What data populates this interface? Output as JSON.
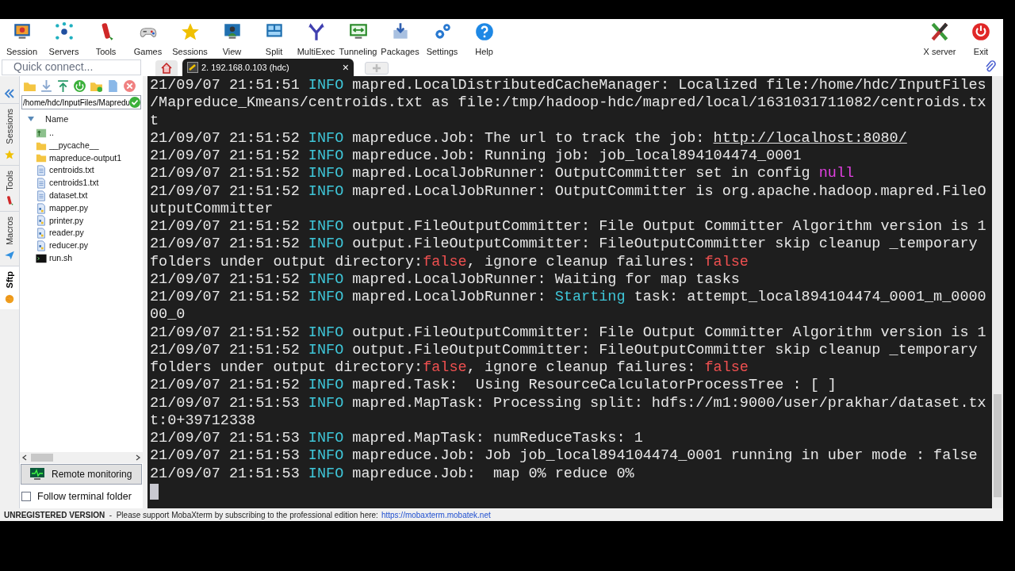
{
  "toolbar": [
    {
      "label": "Session"
    },
    {
      "label": "Servers"
    },
    {
      "label": "Tools"
    },
    {
      "label": "Games"
    },
    {
      "label": "Sessions"
    },
    {
      "label": "View"
    },
    {
      "label": "Split"
    },
    {
      "label": "MultiExec"
    },
    {
      "label": "Tunneling"
    },
    {
      "label": "Packages"
    },
    {
      "label": "Settings"
    },
    {
      "label": "Help"
    }
  ],
  "toolbar_right": [
    {
      "label": "X server"
    },
    {
      "label": "Exit"
    }
  ],
  "quick_connect": {
    "placeholder": "Quick connect..."
  },
  "tabs": [
    {
      "kind": "home",
      "selected": false
    },
    {
      "kind": "session",
      "label": "2. 192.168.0.103 (hdc)",
      "close": "×",
      "selected": true
    },
    {
      "kind": "new",
      "selected": false
    }
  ],
  "side_tabs": [
    {
      "label": "Sessions",
      "selected": false
    },
    {
      "label": "Tools",
      "selected": false
    },
    {
      "label": "Macros",
      "selected": false
    },
    {
      "label": "Sftp",
      "selected": true
    }
  ],
  "sftp": {
    "path": "/home/hdc/InputFiles/Mapredu",
    "column": "Name",
    "files": [
      {
        "name": "..",
        "kind": "parent"
      },
      {
        "name": "__pycache__",
        "kind": "folder"
      },
      {
        "name": "mapreduce-output1",
        "kind": "folder"
      },
      {
        "name": "centroids.txt",
        "kind": "text"
      },
      {
        "name": "centroids1.txt",
        "kind": "text"
      },
      {
        "name": "dataset.txt",
        "kind": "text"
      },
      {
        "name": "mapper.py",
        "kind": "python"
      },
      {
        "name": "printer.py",
        "kind": "python"
      },
      {
        "name": "reader.py",
        "kind": "python"
      },
      {
        "name": "reducer.py",
        "kind": "python"
      },
      {
        "name": "run.sh",
        "kind": "script"
      }
    ],
    "remote_monitoring": "Remote monitoring",
    "follow_folder": {
      "label": "Follow terminal folder",
      "checked": false
    }
  },
  "terminal": [
    [
      {
        "kind": "text",
        "text": "21/09/07 21:51:51 "
      },
      {
        "kind": "info",
        "text": "INFO"
      },
      {
        "kind": "text",
        "text": " mapred.LocalDistributedCacheManager: Localized file:/home/hdc/InputFiles"
      }
    ],
    [
      {
        "kind": "text",
        "text": "/Mapreduce_Kmeans/centroids.txt as file:/tmp/hadoop-hdc/mapred/local/1631031711082/centroids.tx"
      }
    ],
    [
      {
        "kind": "text",
        "text": "t"
      }
    ],
    [
      {
        "kind": "text",
        "text": "21/09/07 21:51:52 "
      },
      {
        "kind": "info",
        "text": "INFO"
      },
      {
        "kind": "text",
        "text": " mapreduce.Job: The url to track the job: "
      },
      {
        "kind": "link",
        "text": "http://localhost:8080/"
      }
    ],
    [
      {
        "kind": "text",
        "text": "21/09/07 21:51:52 "
      },
      {
        "kind": "info",
        "text": "INFO"
      },
      {
        "kind": "text",
        "text": " mapreduce.Job: Running job: job_local894104474_0001"
      }
    ],
    [
      {
        "kind": "text",
        "text": "21/09/07 21:51:52 "
      },
      {
        "kind": "info",
        "text": "INFO"
      },
      {
        "kind": "text",
        "text": " mapred.LocalJobRunner: OutputCommitter set in config "
      },
      {
        "kind": "null",
        "text": "null"
      }
    ],
    [
      {
        "kind": "text",
        "text": "21/09/07 21:51:52 "
      },
      {
        "kind": "info",
        "text": "INFO"
      },
      {
        "kind": "text",
        "text": " mapred.LocalJobRunner: OutputCommitter is org.apache.hadoop.mapred.FileO"
      }
    ],
    [
      {
        "kind": "text",
        "text": "utputCommitter"
      }
    ],
    [
      {
        "kind": "text",
        "text": "21/09/07 21:51:52 "
      },
      {
        "kind": "info",
        "text": "INFO"
      },
      {
        "kind": "text",
        "text": " output.FileOutputCommitter: File Output Committer Algorithm version is 1"
      }
    ],
    [
      {
        "kind": "text",
        "text": "21/09/07 21:51:52 "
      },
      {
        "kind": "info",
        "text": "INFO"
      },
      {
        "kind": "text",
        "text": " output.FileOutputCommitter: FileOutputCommitter skip cleanup _temporary"
      }
    ],
    [
      {
        "kind": "text",
        "text": "folders under output directory:"
      },
      {
        "kind": "false",
        "text": "false"
      },
      {
        "kind": "text",
        "text": ", ignore cleanup failures: "
      },
      {
        "kind": "false",
        "text": "false"
      }
    ],
    [
      {
        "kind": "text",
        "text": "21/09/07 21:51:52 "
      },
      {
        "kind": "info",
        "text": "INFO"
      },
      {
        "kind": "text",
        "text": " mapred.LocalJobRunner: Waiting for map tasks"
      }
    ],
    [
      {
        "kind": "text",
        "text": "21/09/07 21:51:52 "
      },
      {
        "kind": "info",
        "text": "INFO"
      },
      {
        "kind": "text",
        "text": " mapred.LocalJobRunner: "
      },
      {
        "kind": "info",
        "text": "Starting"
      },
      {
        "kind": "text",
        "text": " task: attempt_local894104474_0001_m_0000"
      }
    ],
    [
      {
        "kind": "text",
        "text": "00_0"
      }
    ],
    [
      {
        "kind": "text",
        "text": "21/09/07 21:51:52 "
      },
      {
        "kind": "info",
        "text": "INFO"
      },
      {
        "kind": "text",
        "text": " output.FileOutputCommitter: File Output Committer Algorithm version is 1"
      }
    ],
    [
      {
        "kind": "text",
        "text": "21/09/07 21:51:52 "
      },
      {
        "kind": "info",
        "text": "INFO"
      },
      {
        "kind": "text",
        "text": " output.FileOutputCommitter: FileOutputCommitter skip cleanup _temporary"
      }
    ],
    [
      {
        "kind": "text",
        "text": "folders under output directory:"
      },
      {
        "kind": "false",
        "text": "false"
      },
      {
        "kind": "text",
        "text": ", ignore cleanup failures: "
      },
      {
        "kind": "false",
        "text": "false"
      }
    ],
    [
      {
        "kind": "text",
        "text": "21/09/07 21:51:52 "
      },
      {
        "kind": "info",
        "text": "INFO"
      },
      {
        "kind": "text",
        "text": " mapred.Task:  Using ResourceCalculatorProcessTree : [ ]"
      }
    ],
    [
      {
        "kind": "text",
        "text": "21/09/07 21:51:53 "
      },
      {
        "kind": "info",
        "text": "INFO"
      },
      {
        "kind": "text",
        "text": " mapred.MapTask: Processing split: hdfs://m1:9000/user/prakhar/dataset.tx"
      }
    ],
    [
      {
        "kind": "text",
        "text": "t:0+39712338"
      }
    ],
    [
      {
        "kind": "text",
        "text": "21/09/07 21:51:53 "
      },
      {
        "kind": "info",
        "text": "INFO"
      },
      {
        "kind": "text",
        "text": " mapred.MapTask: numReduceTasks: 1"
      }
    ],
    [
      {
        "kind": "text",
        "text": "21/09/07 21:51:53 "
      },
      {
        "kind": "info",
        "text": "INFO"
      },
      {
        "kind": "text",
        "text": " mapreduce.Job: Job job_local894104474_0001 running in uber mode : false"
      }
    ],
    [
      {
        "kind": "text",
        "text": "21/09/07 21:51:53 "
      },
      {
        "kind": "info",
        "text": "INFO"
      },
      {
        "kind": "text",
        "text": " mapreduce.Job:  map 0% reduce 0%"
      }
    ]
  ],
  "status_bar": {
    "notice": "**UNREGISTERED VERSION**  -  Please support MobaXterm by subscribing to the professional edition here:",
    "link": "https://mobaxterm.mobatek.net"
  }
}
